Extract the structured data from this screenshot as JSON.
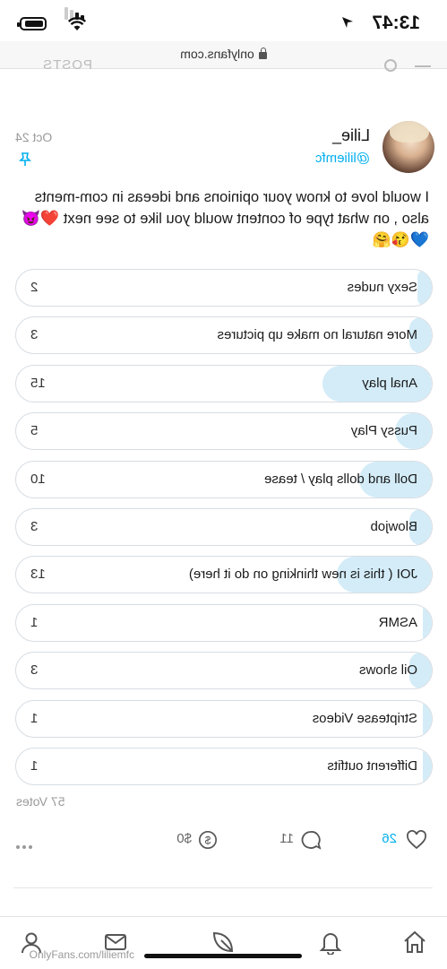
{
  "status_bar": {
    "time": "13:47"
  },
  "browser": {
    "url": "onlyfans.com"
  },
  "profile_tab": {
    "posts_label": "POSTS"
  },
  "post": {
    "author_name": "Lilie_",
    "author_handle": "@liliemfc",
    "date": "Oct 24",
    "caption": "I would love to know your opinions and ideeas in com-ments also , on what type of content would you like to see next",
    "caption_emojis": "❤️😈💙😘🤗",
    "poll": {
      "options": [
        {
          "label": "Sexy nudes",
          "votes": "2",
          "share": 0.035
        },
        {
          "label": "More natural no make up pictures",
          "votes": "3",
          "share": 0.053
        },
        {
          "label": "Anal play",
          "votes": "15",
          "share": 0.263
        },
        {
          "label": "Pussy Play",
          "votes": "5",
          "share": 0.088
        },
        {
          "label": "Doll and dolls play / tease",
          "votes": "10",
          "share": 0.175
        },
        {
          "label": "Blowjob",
          "votes": "3",
          "share": 0.053
        },
        {
          "label": "JOI ( this is new thinking on do it here)",
          "votes": "13",
          "share": 0.228
        },
        {
          "label": "ASMR",
          "votes": "1",
          "share": 0.018
        },
        {
          "label": "Oil shows",
          "votes": "3",
          "share": 0.053
        },
        {
          "label": "Striptease Videos",
          "votes": "1",
          "share": 0.018
        },
        {
          "label": "Different outfits",
          "votes": "1",
          "share": 0.018
        }
      ],
      "total_votes": "57 Votes"
    },
    "likes": "26",
    "comments": "11",
    "tip_label": "$0"
  },
  "footer_url": "OnlyFans.com/liliemfc",
  "colors": {
    "accent": "#00aff0",
    "poll_fill": "#d3ecf8",
    "border": "#d7dde3"
  },
  "icons": {
    "nav": [
      "home-icon",
      "bell-icon",
      "add-post-icon",
      "messages-icon",
      "profile-icon"
    ],
    "actions": [
      "heart-icon",
      "comment-icon",
      "tip-icon",
      "more-icon",
      "pin-icon"
    ]
  }
}
